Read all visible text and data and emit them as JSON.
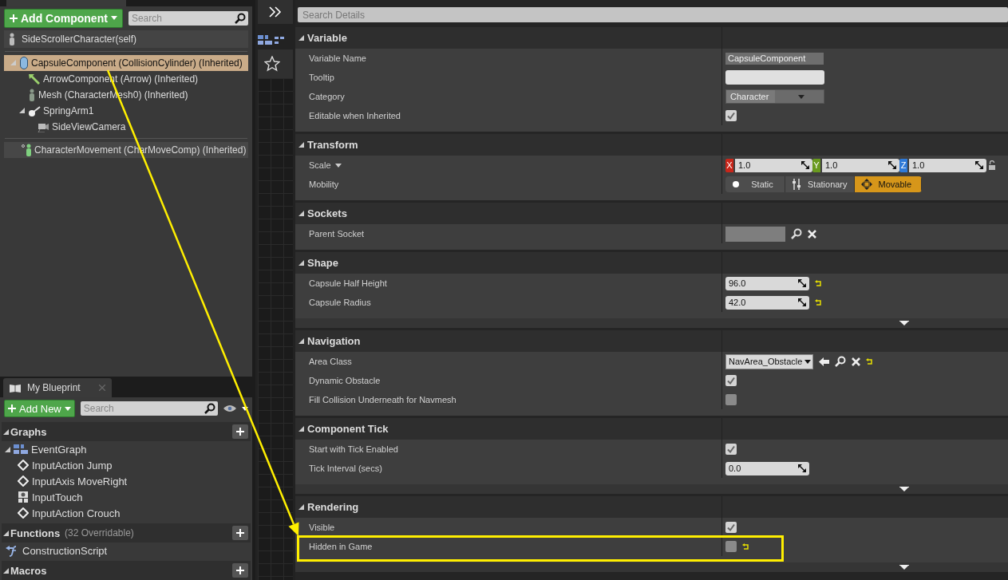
{
  "components": {
    "add_button": "Add Component",
    "search_placeholder": "Search",
    "root": "SideScrollerCharacter(self)",
    "tree": [
      {
        "label": "CapsuleComponent (CollisionCylinder) (Inherited)",
        "kind": "capsule",
        "selected": true,
        "expanded": true,
        "children": [
          {
            "label": "ArrowComponent (Arrow) (Inherited)",
            "kind": "arrow",
            "selected": false,
            "expanded": false
          },
          {
            "label": "Mesh (CharacterMesh0) (Inherited)",
            "kind": "mesh",
            "selected": false,
            "expanded": false
          },
          {
            "label": "SpringArm1",
            "kind": "spring_arm",
            "selected": false,
            "expanded": true,
            "children": [
              {
                "label": "SideViewCamera",
                "kind": "camera",
                "selected": false,
                "expanded": false
              }
            ]
          }
        ]
      }
    ],
    "movement": "CharacterMovement (CharMoveComp) (Inherited)"
  },
  "my_blueprint": {
    "tab": "My Blueprint",
    "add_button": "Add New",
    "search_placeholder": "Search",
    "sections": [
      {
        "title": "Graphs",
        "items": [
          {
            "label": "EventGraph",
            "kind": "graph",
            "expanded": true,
            "children": [
              {
                "label": "InputAction Jump",
                "kind": "event",
                "expanded": false
              },
              {
                "label": "InputAxis MoveRight",
                "kind": "event",
                "expanded": false
              },
              {
                "label": "InputTouch",
                "kind": "touch",
                "expanded": false
              },
              {
                "label": "InputAction Crouch",
                "kind": "event",
                "expanded": false
              }
            ]
          }
        ]
      },
      {
        "title": "Functions",
        "count": "(32 Overridable)",
        "items": [
          {
            "label": "ConstructionScript",
            "kind": "function",
            "expanded": false
          }
        ]
      },
      {
        "title": "Macros"
      }
    ]
  },
  "details": {
    "search_placeholder": "Search Details",
    "sections": [
      {
        "title": "Variable",
        "expander": false,
        "rows": [
          {
            "label": "Variable Name",
            "kind": "readonly_text",
            "value": "CapsuleComponent"
          },
          {
            "label": "Tooltip",
            "kind": "text"
          },
          {
            "label": "Category",
            "kind": "dropdown",
            "value": "Character"
          },
          {
            "label": "Editable when Inherited",
            "kind": "checkbox",
            "checked": true
          }
        ]
      },
      {
        "title": "Transform",
        "expander": false,
        "rows": [
          {
            "label": "Scale",
            "kind": "vector",
            "menu": true,
            "axes": [
              {
                "axis": "X",
                "value": "1.0",
                "color": "#c8261a"
              },
              {
                "axis": "Y",
                "value": "1.0",
                "color": "#6a9a1f"
              },
              {
                "axis": "Z",
                "value": "1.0",
                "color": "#2f7ad8"
              }
            ]
          },
          {
            "label": "Mobility",
            "kind": "mobility",
            "options": [
              {
                "label": "Static",
                "kind": "dot",
                "selected": false
              },
              {
                "label": "Stationary",
                "kind": "sliders",
                "selected": false
              },
              {
                "label": "Movable",
                "kind": "move",
                "selected": true
              }
            ]
          }
        ]
      },
      {
        "title": "Sockets",
        "expander": false,
        "rows": [
          {
            "label": "Parent Socket",
            "kind": "socket"
          }
        ]
      },
      {
        "title": "Shape",
        "expander": true,
        "rows": [
          {
            "label": "Capsule Half Height",
            "kind": "number",
            "value": "96.0",
            "reset": true
          },
          {
            "label": "Capsule Radius",
            "kind": "number",
            "value": "42.0",
            "reset": true
          }
        ]
      },
      {
        "title": "Navigation",
        "expander": false,
        "rows": [
          {
            "label": "Area Class",
            "kind": "class_picker",
            "value": "NavArea_Obstacle",
            "reset": true
          },
          {
            "label": "Dynamic Obstacle",
            "kind": "checkbox",
            "checked": true
          },
          {
            "label": "Fill Collision Underneath for Navmesh",
            "kind": "checkbox",
            "checked": false
          }
        ]
      },
      {
        "title": "Component Tick",
        "expander": true,
        "rows": [
          {
            "label": "Start with Tick Enabled",
            "kind": "checkbox",
            "checked": true
          },
          {
            "label": "Tick Interval (secs)",
            "kind": "number",
            "value": "0.0",
            "reset": false
          }
        ]
      },
      {
        "title": "Rendering",
        "expander": true,
        "rows": [
          {
            "label": "Visible",
            "kind": "checkbox",
            "checked": true,
            "highlighted": false
          },
          {
            "label": "Hidden in Game",
            "kind": "checkbox",
            "checked": false,
            "reset": true,
            "highlighted": true
          }
        ]
      }
    ]
  }
}
